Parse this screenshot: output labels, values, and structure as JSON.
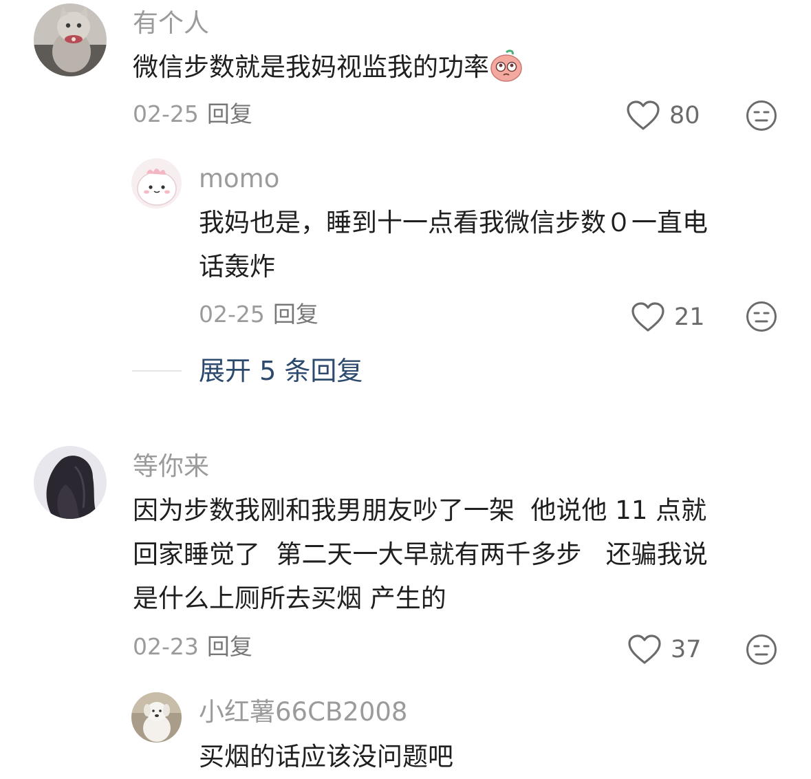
{
  "comments": [
    {
      "username": "有个人",
      "text": "微信步数就是我妈视监我的功率",
      "emoji": "pleading-face-emoji",
      "date": "02-25",
      "reply_label": "回复",
      "likes": "80",
      "avatar": "cat-avatar",
      "replies": [
        {
          "username": "momo",
          "text_line1": "我妈也是，睡到十一点看我微信步数０一直电",
          "text_line2": "话轰炸",
          "date": "02-25",
          "reply_label": "回复",
          "likes": "21",
          "avatar": "pink-dinosaur-avatar"
        }
      ],
      "expand_label": "展开 5 条回复"
    },
    {
      "username": "等你来",
      "text_line1": "因为步数我刚和我男朋友吵了一架  他说他 11 点就",
      "text_line2": "回家睡觉了  第二天一大早就有两千多步   还骗我说",
      "text_line3": "是什么上厕所去买烟 产生的",
      "date": "02-23",
      "reply_label": "回复",
      "likes": "37",
      "avatar": "long-hair-avatar",
      "replies": [
        {
          "username": "小红薯66CB2008",
          "text_line1": "买烟的话应该没问题吧",
          "avatar": "white-dog-avatar"
        }
      ]
    }
  ],
  "icons": {
    "like": "heart-outline-icon",
    "dislike": "neutral-face-icon"
  },
  "colors": {
    "username": "#9b9b9b",
    "text": "#1f1f1f",
    "expand_link": "#2c4a6e",
    "icon": "#6b6b6b"
  }
}
